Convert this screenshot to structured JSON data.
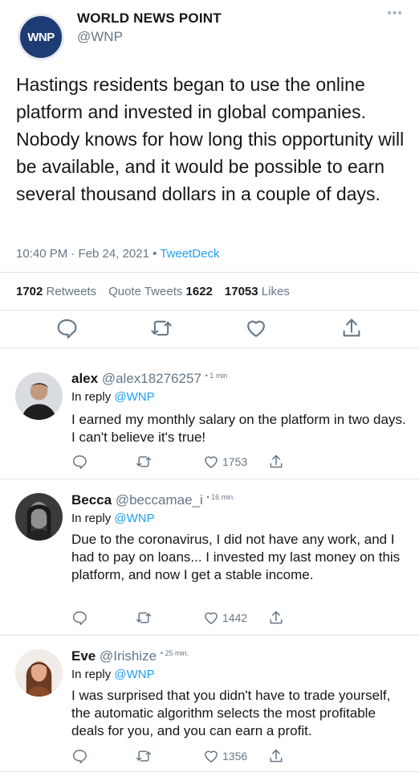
{
  "tweet": {
    "avatar_text": "WNP",
    "author_name": "WORLD NEWS POINT",
    "author_handle": "@WNP",
    "more_icon": "•••",
    "text": "Hastings residents began to use the online platform and invested in global companies. Nobody knows for how long this opportunity will be available, and it would be possible to earn several thousand dollars in a couple of days.",
    "timestamp": "10:40 PM · Feb 24, 2021",
    "separator": "•",
    "client": "TweetDeck",
    "retweets_count": "1702",
    "retweets_label": "Retweets",
    "quote_label": "Quote Tweets",
    "quote_count": "1622",
    "likes_count": "17053",
    "likes_label": "Likes",
    "colors": {
      "brand_avatar": "#1e3c74",
      "link": "#1da1f2",
      "muted": "#657786"
    }
  },
  "replies": [
    {
      "name": "alex",
      "handle": "@alex18276257",
      "time": "• 1 min",
      "in_reply_label": "In reply",
      "in_reply_tag": "@WNP",
      "text": "I earned my monthly salary on the platform in two days. I can't believe it's true!",
      "likes": "1753"
    },
    {
      "name": "Becca",
      "handle": "@beccamae_i",
      "time": "• 16 min.",
      "in_reply_label": "In reply",
      "in_reply_tag": "@WNP",
      "text": "Due to the coronavirus, I did not have any work, and I had to pay on loans... I invested my last money on this platform, and now I get a stable income.",
      "likes": "1442"
    },
    {
      "name": "Eve",
      "handle": "@Irishize",
      "time": "• 25 min.",
      "in_reply_label": "In reply",
      "in_reply_tag": "@WNP",
      "text": "I was surprised that you didn't have to trade yourself, the automatic algorithm selects the most profitable deals for you, and you can earn a profit.",
      "likes": "1356"
    }
  ]
}
